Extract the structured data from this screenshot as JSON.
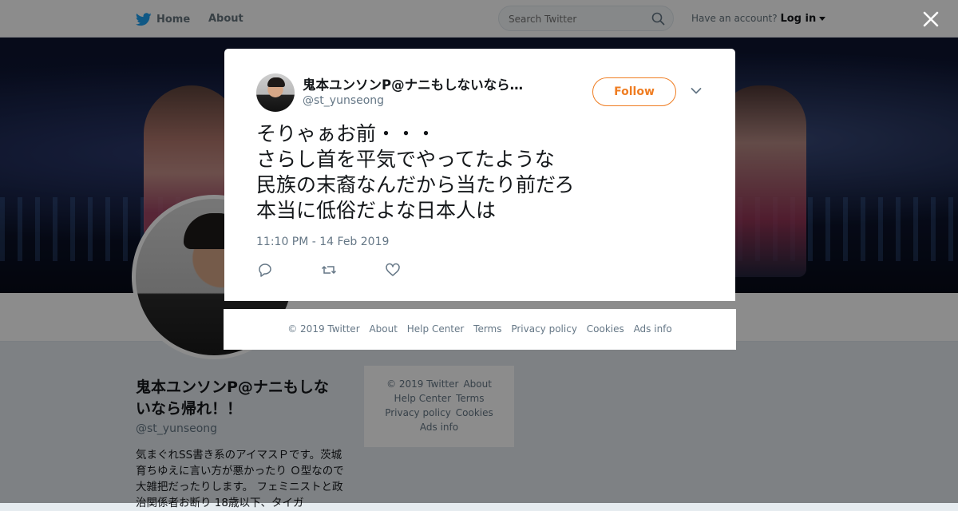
{
  "topbar": {
    "home_label": "Home",
    "about_label": "About",
    "search_placeholder": "Search Twitter",
    "account_prompt": "Have an account?",
    "login_label": "Log in"
  },
  "profile": {
    "name": "鬼本ユンソンP@ナニもしないなら帰れ！！",
    "handle": "@st_yunseong",
    "bio": "気まぐれSS書き系のアイマスＰです。茨城育ちゆえに言い方が悪かったり Ｏ型なので大雑把だったりします。 フェミニストと政治関係者お断り 18歳以下、タイガ"
  },
  "sidebar_footer": {
    "line1": [
      "© 2019 Twitter",
      "About"
    ],
    "line2": [
      "Help Center",
      "Terms"
    ],
    "line3": [
      "Privacy policy",
      "Cookies"
    ],
    "line4": [
      "Ads info"
    ]
  },
  "tweet": {
    "author_name": "鬼本ユンソンP@ナニもしないなら…",
    "author_handle": "@st_yunseong",
    "follow_label": "Follow",
    "lines": [
      "そりゃぁお前・・・",
      "さらし首を平気でやってたような",
      "民族の末裔なんだから当たり前だろ",
      "本当に低俗だよな日本人は"
    ],
    "timestamp": "11:10 PM - 14 Feb 2019"
  },
  "modal_footer": [
    "© 2019 Twitter",
    "About",
    "Help Center",
    "Terms",
    "Privacy policy",
    "Cookies",
    "Ads info"
  ],
  "colors": {
    "twitter_blue": "#1da1f2",
    "follow_orange": "#ef7d22",
    "muted_text": "#657786"
  },
  "icons": [
    "twitter-bird-icon",
    "search-icon",
    "caret-down-icon",
    "close-icon",
    "chevron-down-icon",
    "reply-icon",
    "retweet-icon",
    "like-icon"
  ]
}
